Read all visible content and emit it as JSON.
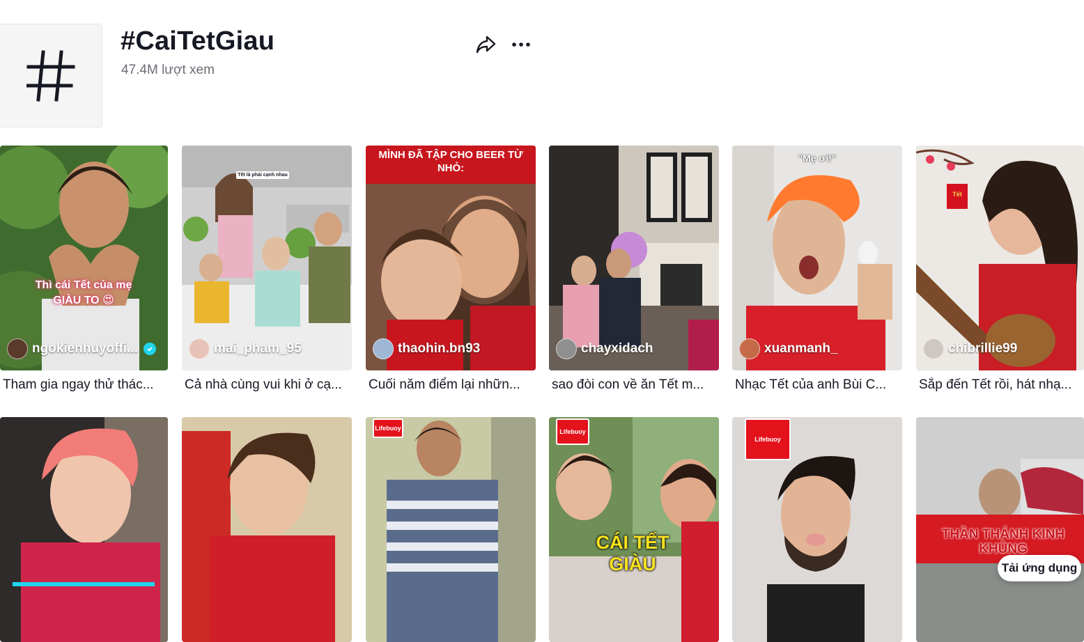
{
  "header": {
    "tag_symbol": "#",
    "title": "#CaiTetGiau",
    "views": "47.4M lượt xem",
    "share_icon": "share-arrow-icon",
    "more_icon": "more-horizontal-icon"
  },
  "videos": [
    {
      "author": "ngokienhuyoffi...",
      "verified": true,
      "caption": "Tham gia ngay thử thác...",
      "overlay": "Thì cái Tết của mẹ GIÀU TO 😍"
    },
    {
      "author": "mai_pham_95",
      "verified": false,
      "caption": "Cả nhà cùng vui khi ở cạ...",
      "overlay": "Tết là phải cạnh nhau"
    },
    {
      "author": "thaohin.bn93",
      "verified": false,
      "caption": "Cuối năm điểm lại nhữn...",
      "overlay": "MÌNH ĐÃ TẬP CHO BEER TỪ NHỎ:"
    },
    {
      "author": "chayxidach",
      "verified": false,
      "caption": "sao đòi con về ăn Tết m..."
    },
    {
      "author": "xuanmanh_",
      "verified": false,
      "caption": "Nhạc Tết của anh Bùi C...",
      "overlay": "\"Mẹ ơi!\""
    },
    {
      "author": "chibrillie99",
      "verified": false,
      "caption": "Sắp đến Tết rồi, hát nhạ...",
      "overlay": "Tết"
    },
    {
      "author": "",
      "caption": ""
    },
    {
      "author": "",
      "caption": ""
    },
    {
      "author": "",
      "caption": "",
      "overlay": "Lifebuoy"
    },
    {
      "author": "",
      "caption": "",
      "overlay": "CÁI TẾT GIÀU"
    },
    {
      "author": "",
      "caption": "",
      "overlay": "Lifebuoy"
    },
    {
      "author": "",
      "caption": "",
      "overlay": "THẦN THÁNH KINH KHỦNG"
    }
  ],
  "app_button": "Tải ứng dụng",
  "colors": {
    "accent": "#20d5ec",
    "text": "#161823",
    "muted": "#6b6d74",
    "lifebuoy_red": "#e3121b"
  }
}
